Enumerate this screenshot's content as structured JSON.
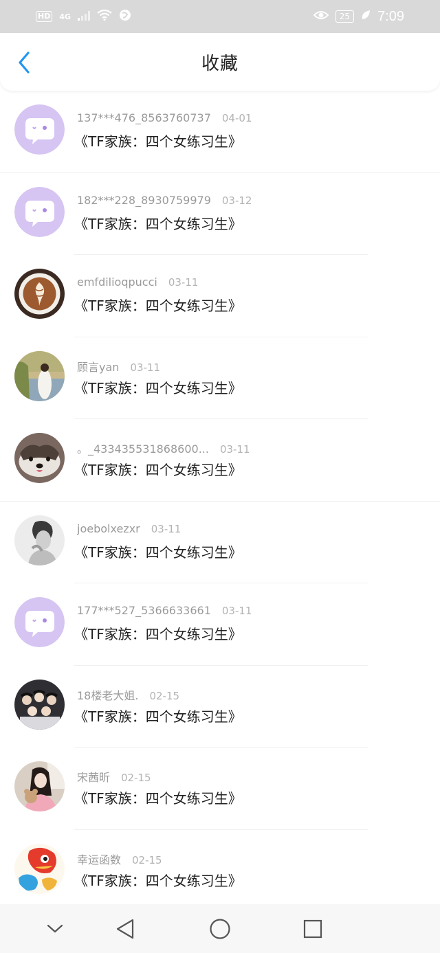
{
  "status_bar": {
    "hd": "HD",
    "network": "4G",
    "battery": "25",
    "time": "7:09",
    "icons": [
      "signal-icon",
      "wifi-icon",
      "vpn-icon",
      "eye-icon",
      "battery-icon",
      "leaf-icon"
    ]
  },
  "header": {
    "title": "收藏",
    "back_icon": "chevron-left-icon",
    "accent_color": "#2196f3"
  },
  "items": [
    {
      "name": "137***476_8563760737",
      "date": "04-01",
      "title": "《TF家族：四个女练习生》",
      "avatar": "default-chat-avatar"
    },
    {
      "name": "182***228_8930759979",
      "date": "03-12",
      "title": "《TF家族：四个女练习生》",
      "avatar": "default-chat-avatar"
    },
    {
      "name": "emfdilioqpucci",
      "date": "03-11",
      "title": "《TF家族：四个女练习生》",
      "avatar": "latte-art-avatar"
    },
    {
      "name": "顾言yan",
      "date": "03-11",
      "title": "《TF家族：四个女练习生》",
      "avatar": "girl-by-lake-avatar"
    },
    {
      "name": "。_433435531868600...",
      "date": "03-11",
      "title": "《TF家族：四个女练习生》",
      "avatar": "dog-avatar"
    },
    {
      "name": "joebolxezxr",
      "date": "03-11",
      "title": "《TF家族：四个女练习生》",
      "avatar": "bw-portrait-avatar"
    },
    {
      "name": "177***527_5366633661",
      "date": "03-11",
      "title": "《TF家族：四个女练习生》",
      "avatar": "default-chat-avatar"
    },
    {
      "name": "18楼老大姐.",
      "date": "02-15",
      "title": "《TF家族：四个女练习生》",
      "avatar": "group-photo-avatar"
    },
    {
      "name": "宋茜昕",
      "date": "02-15",
      "title": "《TF家族：四个女练习生》",
      "avatar": "girl-with-plush-avatar"
    },
    {
      "name": "幸运函数",
      "date": "02-15",
      "title": "《TF家族：四个女练习生》",
      "avatar": "cartoon-fish-avatar"
    }
  ],
  "nav_bar": {
    "icons": [
      "hide-keyboard-icon",
      "back-triangle-icon",
      "home-circle-icon",
      "recents-square-icon"
    ]
  }
}
